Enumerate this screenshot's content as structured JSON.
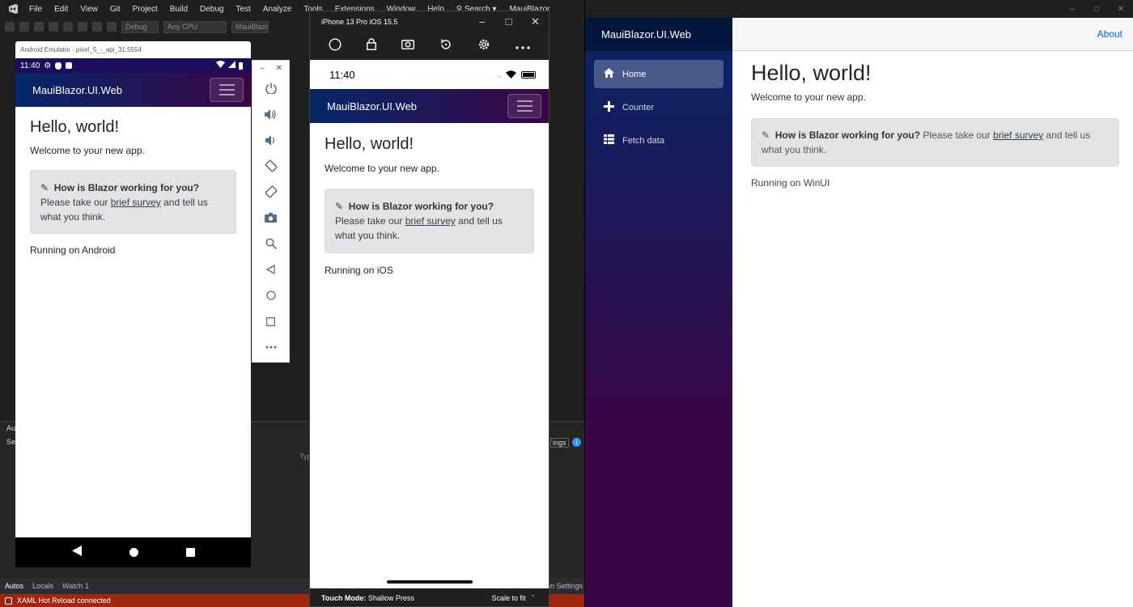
{
  "vs": {
    "menu": [
      "File",
      "Edit",
      "View",
      "Git",
      "Project",
      "Build",
      "Debug",
      "Test",
      "Analyze",
      "Tools",
      "Extensions",
      "Window",
      "Help"
    ],
    "search_label": "Search",
    "solution_name": "MauiBlazor",
    "toolbar": {
      "config": "Debug",
      "platform": "Any CPU",
      "target": "MauiBlazor"
    },
    "bottom_tabs": [
      "Autos",
      "Locals",
      "Watch 1"
    ],
    "status_text": "XAML Hot Reload connected",
    "panel_fragments": {
      "aut": "Aut",
      "sea": "Sea",
      "typ": "Typ",
      "ings": "ings",
      "ion_settings": "ion Settings"
    }
  },
  "android": {
    "window_title": "Android Emulator - pixel_5_-_api_31:5554",
    "status_time": "11:40",
    "brand": "MauiBlazor.UI.Web",
    "page": {
      "heading": "Hello, world!",
      "welcome": "Welcome to your new app.",
      "survey_question": "How is Blazor working for you?",
      "survey_pre": "Please take our",
      "survey_link": "brief survey",
      "survey_post": "and tell us what you think.",
      "running": "Running on Android"
    }
  },
  "emu_tools": [
    "power-icon",
    "volume-up-icon",
    "volume-down-icon",
    "rotate-left-icon",
    "rotate-right-icon",
    "camera-icon",
    "zoom-icon",
    "back-icon",
    "home-icon",
    "overview-icon",
    "more-icon"
  ],
  "iphone": {
    "window_title": "iPhone 13 Pro iOS 15.5",
    "status_time": "11:40",
    "brand": "MauiBlazor.UI.Web",
    "page": {
      "heading": "Hello, world!",
      "welcome": "Welcome to your new app.",
      "survey_question": "How is Blazor working for you?",
      "survey_pre": "Please take our",
      "survey_link": "brief survey",
      "survey_post": "and tell us what you think.",
      "running": "Running on iOS"
    },
    "touch_mode_label": "Touch Mode:",
    "touch_mode_value": "Shallow Press",
    "scale_label": "Scale to fit"
  },
  "winui": {
    "brand": "MauiBlazor.UI.Web",
    "about": "About",
    "nav": [
      {
        "label": "Home",
        "icon": "home-icon"
      },
      {
        "label": "Counter",
        "icon": "plus-icon"
      },
      {
        "label": "Fetch data",
        "icon": "list-icon"
      }
    ],
    "page": {
      "heading": "Hello, world!",
      "welcome": "Welcome to your new app.",
      "survey_question": "How is Blazor working for you?",
      "survey_pre": "Please take our",
      "survey_link": "brief survey",
      "survey_post": "and tell us what you think.",
      "running": "Running on WinUI"
    }
  }
}
